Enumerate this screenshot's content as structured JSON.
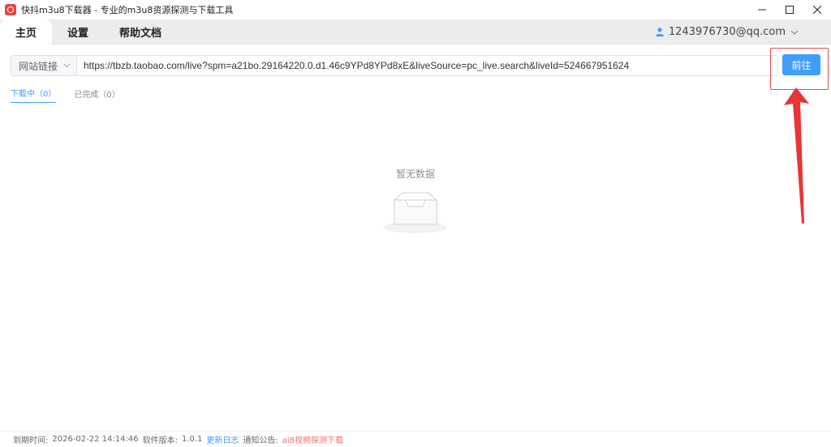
{
  "window": {
    "title": "快抖m3u8下载器 - 专业的m3u8资源探测与下载工具",
    "controls": [
      "minimize-icon",
      "maximize-icon",
      "close-icon"
    ]
  },
  "nav": {
    "tabs": [
      {
        "label": "主页",
        "active": true
      },
      {
        "label": "设置",
        "active": false
      },
      {
        "label": "帮助文档",
        "active": false
      }
    ],
    "user": "1243976730@qq.com"
  },
  "url_bar": {
    "source_select": "网站链接",
    "url_value": "https://tbzb.taobao.com/live?spm=a21bo.29164220.0.d1.46c9YPd8YPd8xE&liveSource=pc_live.search&liveId=524667951624",
    "go_label": "前往"
  },
  "sub_tabs": [
    {
      "label": "下载中（0）",
      "active": true
    },
    {
      "label": "已完成（0）",
      "active": false
    }
  ],
  "empty_state": {
    "text": "暂无数据",
    "icon": "empty-box-icon"
  },
  "footer": {
    "expire_label": "到期时间:",
    "expire_value": "2026-02-22 14:14:46",
    "version_label": "软件版本:",
    "version_value": "1.0.1",
    "changelog_label": "更新日志",
    "notice_label": "通知公告:",
    "notice_value": "ai8视频探测下载"
  },
  "colors": {
    "accent": "#409eff",
    "highlight": "#e84a4a",
    "notice": "#f56c6c"
  }
}
